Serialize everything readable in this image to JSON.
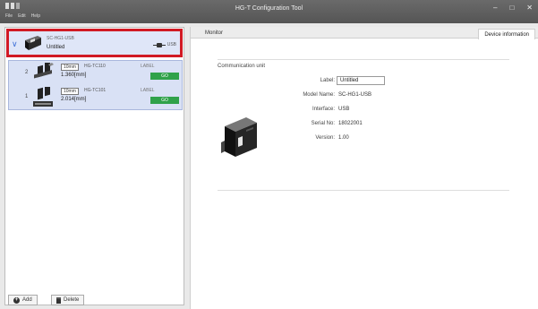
{
  "app": {
    "title": "HG-T Configuration Tool",
    "menu": [
      "File",
      "Edit",
      "Help"
    ],
    "controls": [
      "–",
      "□",
      "✕"
    ]
  },
  "left_panel": {
    "unit": {
      "model": "SC-HG1-USB",
      "name": "Untitled",
      "connection": "USB"
    },
    "sensors": [
      {
        "index": "2",
        "range": "10mm",
        "model": "HG-TC110",
        "value": "1.360[mm]",
        "label_heading": "LABEL",
        "judgement": "GO"
      },
      {
        "index": "1",
        "range": "10mm",
        "model": "HG-TC101",
        "value": "2.014[mm]",
        "label_heading": "LABEL",
        "judgement": "GO"
      }
    ],
    "buttons": {
      "add": "Add",
      "delete": "Delete"
    }
  },
  "right_panel": {
    "tabs": {
      "monitor": "Monitor",
      "device_info": "Device information"
    },
    "section_title": "Communication unit",
    "fields": {
      "label_key": "Label:",
      "label_value": "Untitled",
      "model_key": "Model Name:",
      "model_value": "SC-HG1-USB",
      "interface_key": "Interface:",
      "interface_value": "USB",
      "serial_key": "Serial No:",
      "serial_value": "18022001",
      "version_key": "Version:",
      "version_value": "1.00"
    }
  },
  "colors": {
    "titlebar": "#555555",
    "selection_border": "#d11a24",
    "selected_bg": "#dfe6f8",
    "go_green": "#30a24a"
  },
  "icons": [
    "app-icon",
    "chevron-down-icon",
    "communication-unit-icon",
    "usb-plug-icon",
    "sensor-head-icon",
    "plus-icon",
    "trash-icon"
  ]
}
